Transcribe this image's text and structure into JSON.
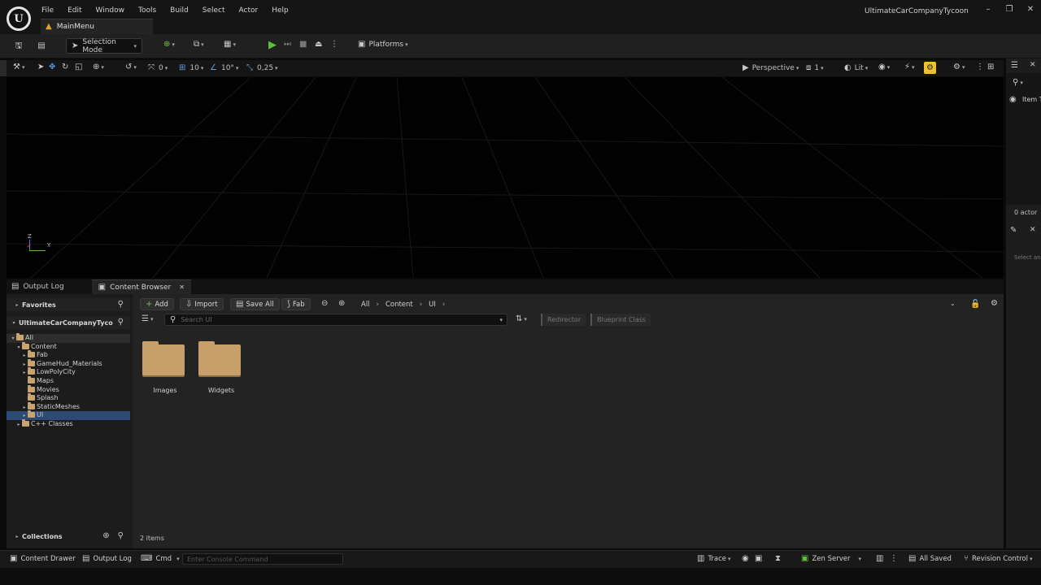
{
  "menu": {
    "items": [
      "File",
      "Edit",
      "Window",
      "Tools",
      "Build",
      "Select",
      "Actor",
      "Help"
    ]
  },
  "window": {
    "title": "UltimateCarCompanyTycoon",
    "tab": "MainMenu"
  },
  "toolbar": {
    "mode": "Selection Mode",
    "platforms": "Platforms"
  },
  "viewport_bar": {
    "rot_snap": "0",
    "move_snap": "10",
    "angle_snap": "10°",
    "scale_snap": "0,25",
    "view": "Perspective",
    "cam_speed": "1",
    "lit": "Lit"
  },
  "right_panel": {
    "item": "Item T",
    "actors": "0 actor",
    "select": "Select an"
  },
  "lower_tabs": {
    "output_log": "Output Log",
    "content_browser": "Content Browser"
  },
  "content_browser": {
    "favorites": "Favorites",
    "project": "UltimateCarCompanyTyco",
    "tree": [
      {
        "label": "All",
        "indent": 0,
        "arrow": "▾",
        "selected": false,
        "root": true
      },
      {
        "label": "Content",
        "indent": 1,
        "arrow": "▾",
        "selected": false
      },
      {
        "label": "Fab",
        "indent": 2,
        "arrow": "▸",
        "selected": false
      },
      {
        "label": "GameHud_Materials",
        "indent": 2,
        "arrow": "▸",
        "selected": false
      },
      {
        "label": "LowPolyCity",
        "indent": 2,
        "arrow": "▸",
        "selected": false
      },
      {
        "label": "Maps",
        "indent": 2,
        "arrow": "",
        "selected": false
      },
      {
        "label": "Movies",
        "indent": 2,
        "arrow": "",
        "selected": false
      },
      {
        "label": "Splash",
        "indent": 2,
        "arrow": "",
        "selected": false
      },
      {
        "label": "StaticMeshes",
        "indent": 2,
        "arrow": "▸",
        "selected": false
      },
      {
        "label": "UI",
        "indent": 2,
        "arrow": "▸",
        "selected": true
      },
      {
        "label": "C++ Classes",
        "indent": 1,
        "arrow": "▸",
        "selected": false
      }
    ],
    "collections": "Collections",
    "add": "Add",
    "import": "Import",
    "save_all": "Save All",
    "fab": "Fab",
    "breadcrumb": [
      "All",
      "Content",
      "UI"
    ],
    "search_placeholder": "Search UI",
    "filter_redirector": "Redirector",
    "filter_blueprint": "Blueprint Class",
    "items": [
      {
        "label": "Images"
      },
      {
        "label": "Widgets"
      }
    ],
    "item_count": "2 items"
  },
  "statusbar": {
    "content_drawer": "Content Drawer",
    "output_log": "Output Log",
    "cmd": "Cmd",
    "console_placeholder": "Enter Console Command",
    "trace": "Trace",
    "zen": "Zen Server",
    "saved": "All Saved",
    "revision": "Revision Control"
  },
  "colors": {
    "play_green": "#5fbf3a",
    "folder": "#c69f6b",
    "highlight": "#f2c12e",
    "selection": "#2c4a73"
  }
}
